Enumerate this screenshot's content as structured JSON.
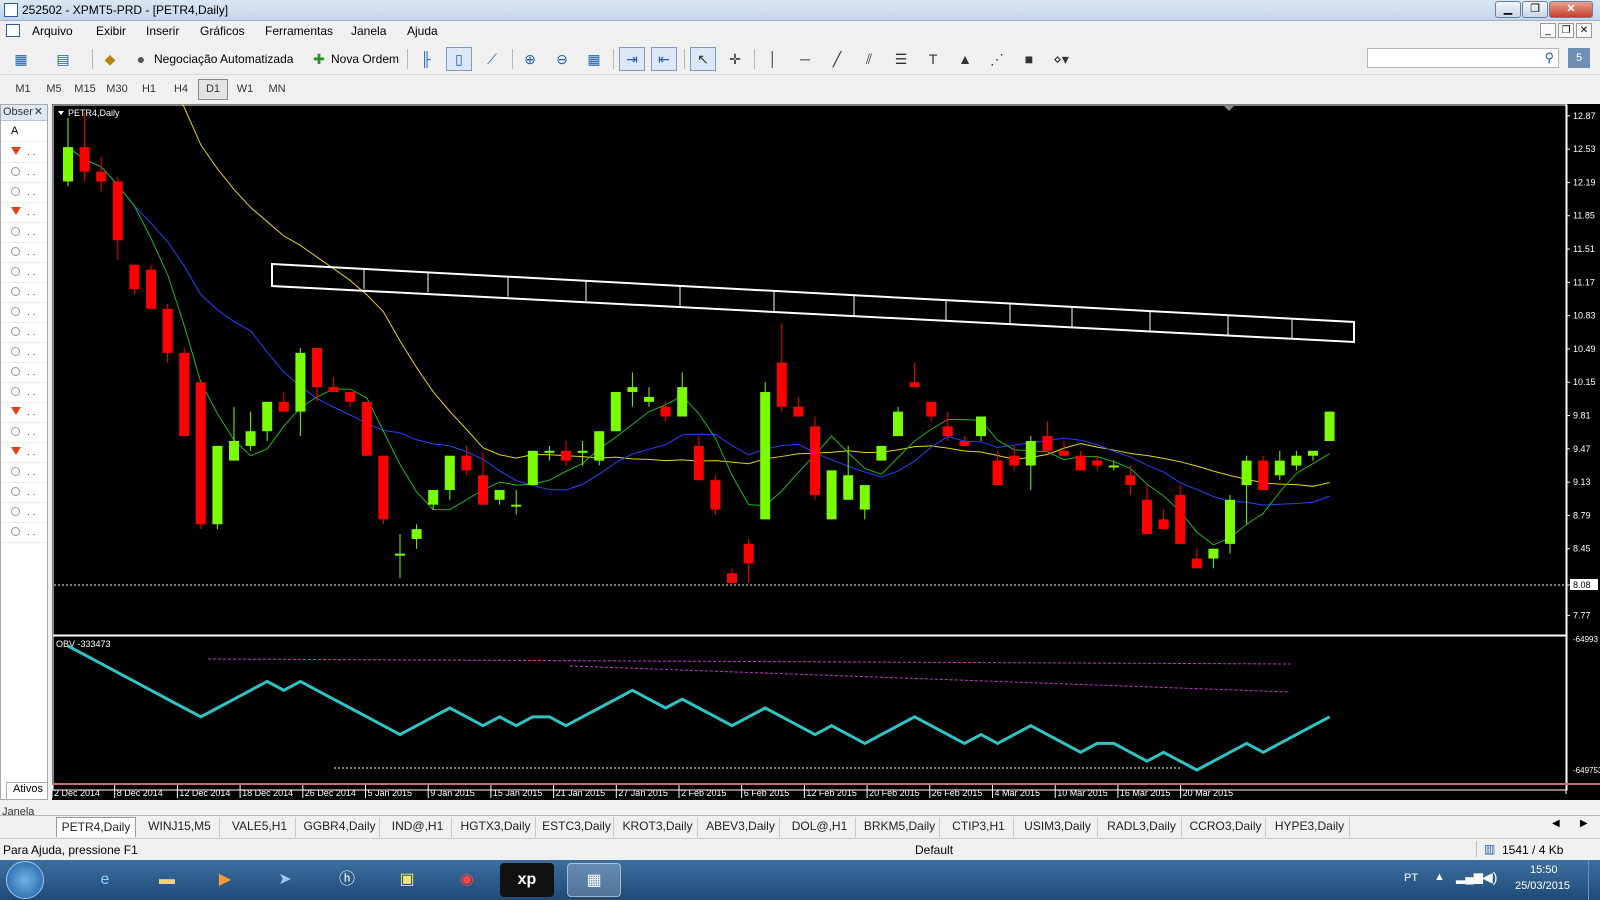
{
  "window": {
    "title": "252502 - XPMT5-PRD - [PETR4,Daily]"
  },
  "menu": {
    "items": [
      "Arquivo",
      "Exibir",
      "Inserir",
      "Gráficos",
      "Ferramentas",
      "Janela",
      "Ajuda"
    ]
  },
  "toolbar": {
    "auto_trading_label": "Negociação Automatizada",
    "new_order_label": "Nova Ordem"
  },
  "timeframes": {
    "items": [
      "M1",
      "M5",
      "M15",
      "M30",
      "H1",
      "H4",
      "D1",
      "W1",
      "MN"
    ],
    "active": "D1"
  },
  "observer": {
    "header": "Obser",
    "first_letter": "A",
    "tab_label": "Ativos"
  },
  "chart": {
    "symbol_label": "PETR4,Daily",
    "price_axis": [
      "12.87",
      "12.53",
      "12.19",
      "11.85",
      "11.51",
      "11.17",
      "10.83",
      "10.49",
      "10.15",
      "9.81",
      "9.47",
      "9.13",
      "8.79",
      "8.45",
      "8.08",
      "7.77"
    ],
    "indicator_label": "OBV -333473",
    "indicator_axis": [
      "-64993",
      "-649753"
    ],
    "date_axis": [
      "2 Dec 2014",
      "8 Dec 2014",
      "12 Dec 2014",
      "18 Dec 2014",
      "26 Dec 2014",
      "5 Jan 2015",
      "9 Jan 2015",
      "15 Jan 2015",
      "21 Jan 2015",
      "27 Jan 2015",
      "2 Feb 2015",
      "6 Feb 2015",
      "12 Feb 2015",
      "20 Feb 2015",
      "26 Feb 2015",
      "4 Mar 2015",
      "10 Mar 2015",
      "16 Mar 2015",
      "20 Mar 2015"
    ],
    "colors": {
      "bull": "#7cfc00",
      "bear": "#ff0000",
      "ma_fast": "#22b522",
      "ma_mid": "#2244ff",
      "ma_slow": "#e6d21a",
      "obv": "#2ec4c4",
      "trend": "#cc33cc"
    }
  },
  "tabs": {
    "window_label": "Janela",
    "items": [
      "PETR4,Daily",
      "WINJ15,M5",
      "VALE5,H1",
      "GGBR4,Daily",
      "IND@,H1",
      "HGTX3,Daily",
      "ESTC3,Daily",
      "KROT3,Daily",
      "ABEV3,Daily",
      "DOL@,H1",
      "BRKM5,Daily",
      "CTIP3,H1",
      "USIM3,Daily",
      "RADL3,Daily",
      "CCRO3,Daily",
      "HYPE3,Daily"
    ],
    "active": "PETR4,Daily"
  },
  "status": {
    "help": "Para Ajuda, pressione F1",
    "profile": "Default",
    "traffic": "1541 / 4 Kb"
  },
  "taskbar": {
    "lang": "PT",
    "time": "15:50",
    "date": "25/03/2015"
  },
  "chart_data": {
    "type": "candlestick",
    "title": "PETR4,Daily",
    "candles": [
      [
        12.2,
        12.85,
        12.15,
        12.55
      ],
      [
        12.55,
        12.9,
        12.2,
        12.3
      ],
      [
        12.3,
        12.45,
        12.1,
        12.2
      ],
      [
        12.2,
        12.25,
        11.4,
        11.6
      ],
      [
        11.35,
        11.35,
        11.05,
        11.1
      ],
      [
        11.3,
        11.35,
        10.9,
        10.9
      ],
      [
        10.9,
        10.95,
        10.35,
        10.45
      ],
      [
        10.45,
        10.5,
        9.6,
        9.6
      ],
      [
        10.15,
        10.15,
        8.65,
        8.7
      ],
      [
        8.7,
        9.5,
        8.65,
        9.5
      ],
      [
        9.35,
        9.9,
        9.35,
        9.55
      ],
      [
        9.5,
        9.85,
        9.45,
        9.65
      ],
      [
        9.65,
        9.95,
        9.55,
        9.95
      ],
      [
        9.95,
        10.05,
        9.85,
        9.85
      ],
      [
        9.85,
        10.5,
        9.6,
        10.45
      ],
      [
        10.5,
        10.5,
        9.95,
        10.1
      ],
      [
        10.1,
        10.2,
        10.05,
        10.05
      ],
      [
        10.05,
        10.05,
        9.9,
        9.95
      ],
      [
        9.95,
        9.95,
        9.4,
        9.4
      ],
      [
        9.4,
        9.4,
        8.7,
        8.75
      ],
      [
        8.4,
        8.6,
        8.15,
        8.4
      ],
      [
        8.55,
        8.7,
        8.45,
        8.65
      ],
      [
        8.9,
        9.05,
        8.85,
        9.05
      ],
      [
        9.05,
        9.35,
        8.95,
        9.4
      ],
      [
        9.4,
        9.5,
        9.2,
        9.25
      ],
      [
        9.2,
        9.45,
        8.9,
        8.9
      ],
      [
        8.95,
        9.05,
        8.9,
        9.05
      ],
      [
        8.9,
        9.05,
        8.8,
        8.9
      ],
      [
        9.1,
        9.45,
        9.1,
        9.45
      ],
      [
        9.45,
        9.5,
        9.35,
        9.45
      ],
      [
        9.45,
        9.55,
        9.3,
        9.35
      ],
      [
        9.45,
        9.55,
        9.3,
        9.45
      ],
      [
        9.35,
        9.65,
        9.3,
        9.65
      ],
      [
        9.65,
        9.95,
        9.65,
        10.05
      ],
      [
        10.05,
        10.25,
        9.9,
        10.1
      ],
      [
        9.95,
        10.1,
        9.9,
        10.0
      ],
      [
        9.9,
        9.95,
        9.75,
        9.8
      ],
      [
        9.8,
        10.25,
        9.8,
        10.1
      ],
      [
        9.5,
        9.6,
        9.15,
        9.15
      ],
      [
        9.15,
        9.2,
        8.8,
        8.85
      ],
      [
        8.2,
        8.25,
        8.1,
        8.1
      ],
      [
        8.5,
        8.55,
        8.1,
        8.3
      ],
      [
        8.75,
        10.15,
        8.75,
        10.05
      ],
      [
        10.35,
        10.75,
        9.85,
        9.9
      ],
      [
        9.9,
        10.0,
        9.8,
        9.8
      ],
      [
        9.7,
        9.8,
        8.95,
        9.0
      ],
      [
        8.75,
        9.25,
        8.75,
        9.25
      ],
      [
        8.95,
        9.5,
        8.95,
        9.2
      ],
      [
        8.85,
        9.05,
        8.75,
        9.1
      ],
      [
        9.35,
        9.5,
        9.35,
        9.5
      ],
      [
        9.6,
        9.9,
        9.6,
        9.85
      ],
      [
        10.15,
        10.35,
        10.1,
        10.1
      ],
      [
        9.95,
        9.95,
        9.75,
        9.8
      ],
      [
        9.7,
        9.85,
        9.55,
        9.6
      ],
      [
        9.55,
        9.6,
        9.5,
        9.5
      ],
      [
        9.6,
        9.8,
        9.55,
        9.8
      ],
      [
        9.35,
        9.45,
        9.1,
        9.1
      ],
      [
        9.4,
        9.5,
        9.25,
        9.3
      ],
      [
        9.3,
        9.6,
        9.05,
        9.55
      ],
      [
        9.6,
        9.75,
        9.5,
        9.45
      ],
      [
        9.45,
        9.55,
        9.4,
        9.4
      ],
      [
        9.4,
        9.45,
        9.25,
        9.25
      ],
      [
        9.35,
        9.4,
        9.25,
        9.3
      ],
      [
        9.3,
        9.35,
        9.25,
        9.3
      ],
      [
        9.2,
        9.3,
        9.0,
        9.1
      ],
      [
        8.95,
        9.1,
        8.6,
        8.6
      ],
      [
        8.75,
        8.85,
        8.65,
        8.65
      ],
      [
        9.0,
        9.1,
        8.5,
        8.5
      ],
      [
        8.35,
        8.45,
        8.25,
        8.25
      ],
      [
        8.35,
        8.45,
        8.25,
        8.45
      ],
      [
        8.5,
        9.0,
        8.4,
        8.95
      ],
      [
        9.1,
        9.4,
        8.7,
        9.35
      ],
      [
        9.35,
        9.4,
        9.05,
        9.05
      ],
      [
        9.2,
        9.45,
        9.15,
        9.35
      ],
      [
        9.3,
        9.45,
        9.25,
        9.4
      ],
      [
        9.4,
        9.45,
        9.35,
        9.45
      ],
      [
        9.55,
        9.85,
        9.55,
        9.85
      ]
    ],
    "ylim": [
      7.6,
      12.95
    ],
    "indicator": {
      "name": "OBV",
      "last": -333473,
      "ylim": [
        -649753,
        -64993
      ]
    }
  }
}
